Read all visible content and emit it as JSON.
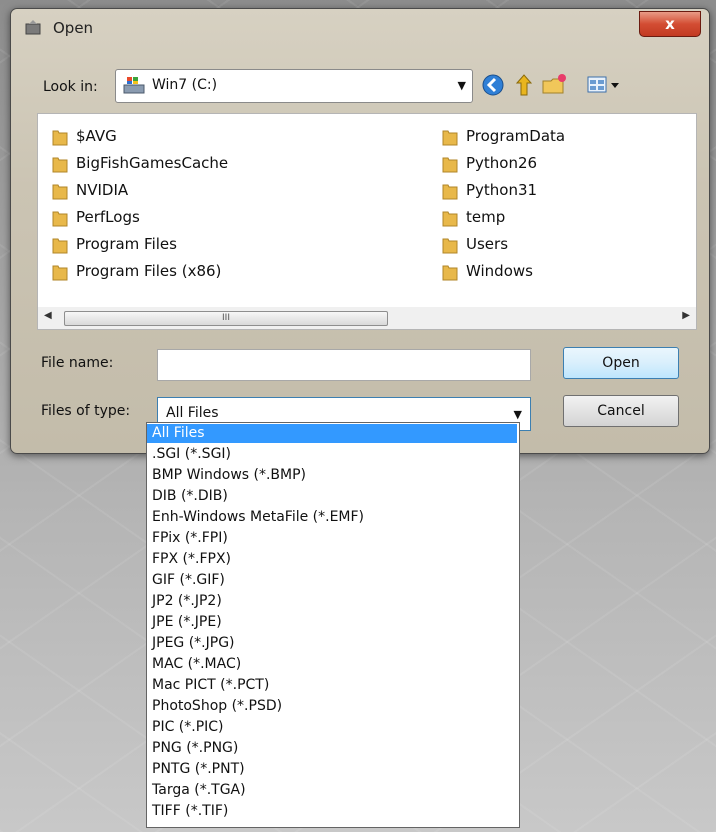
{
  "window": {
    "title": "Open",
    "close_label": "x"
  },
  "lookin": {
    "label": "Look in:",
    "value": "Win7 (C:)"
  },
  "toolbar": {
    "icons": [
      "back-icon",
      "up-folder-icon",
      "new-folder-icon",
      "view-menu-icon"
    ]
  },
  "folders_left": [
    "$AVG",
    "BigFishGamesCache",
    "NVIDIA",
    "PerfLogs",
    "Program Files",
    "Program Files (x86)"
  ],
  "folders_right": [
    "ProgramData",
    "Python26",
    "Python31",
    "temp",
    "Users",
    "Windows"
  ],
  "scrollbar": {
    "thumb_grip": "III"
  },
  "filename": {
    "label": "File name:",
    "value": ""
  },
  "filetype": {
    "label": "Files of type:",
    "value": "All Files",
    "options": [
      "All Files",
      ".SGI (*.SGI)",
      "BMP Windows (*.BMP)",
      "DIB (*.DIB)",
      "Enh-Windows MetaFile (*.EMF)",
      "FPix (*.FPI)",
      "FPX (*.FPX)",
      "GIF (*.GIF)",
      "JP2 (*.JP2)",
      "JPE (*.JPE)",
      "JPEG (*.JPG)",
      "MAC (*.MAC)",
      "Mac PICT (*.PCT)",
      "PhotoShop (*.PSD)",
      "PIC (*.PIC)",
      "PNG (*.PNG)",
      "PNTG (*.PNT)",
      "Targa (*.TGA)",
      "TIFF (*.TIF)"
    ]
  },
  "buttons": {
    "open": "Open",
    "cancel": "Cancel"
  },
  "colors": {
    "selection": "#3399ff",
    "close_button": "#d34d33",
    "folder": "#e8b84a"
  }
}
